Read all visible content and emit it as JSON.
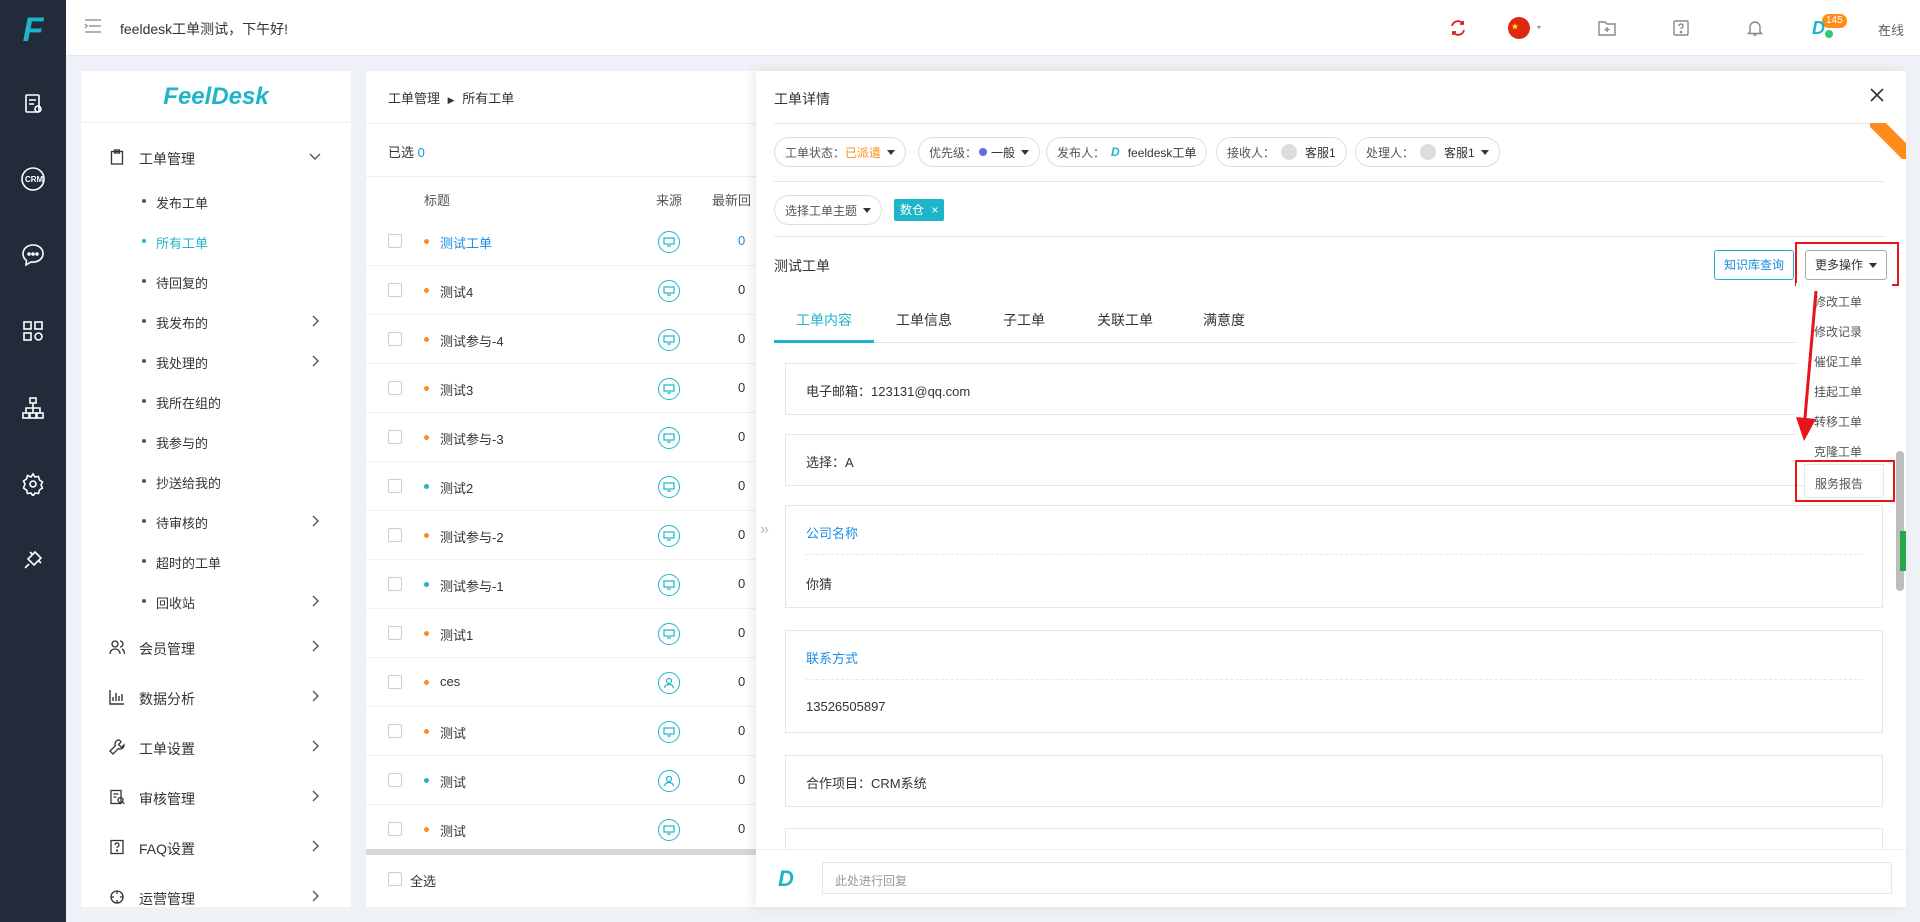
{
  "topbar": {
    "greeting": "feeldesk工单测试，下午好!",
    "notify_count": "145",
    "status": "在线"
  },
  "sidebar": {
    "brand": "FeelDesk",
    "groups": [
      {
        "label": "工单管理"
      },
      {
        "label": "会员管理"
      },
      {
        "label": "数据分析"
      },
      {
        "label": "工单设置"
      },
      {
        "label": "审核管理"
      },
      {
        "label": "FAQ设置"
      },
      {
        "label": "运营管理"
      }
    ],
    "items": [
      {
        "label": "发布工单"
      },
      {
        "label": "所有工单"
      },
      {
        "label": "待回复的"
      },
      {
        "label": "我发布的"
      },
      {
        "label": "我处理的"
      },
      {
        "label": "我所在组的"
      },
      {
        "label": "我参与的"
      },
      {
        "label": "抄送给我的"
      },
      {
        "label": "待审核的"
      },
      {
        "label": "超时的工单"
      },
      {
        "label": "回收站"
      }
    ]
  },
  "list": {
    "breadcrumb_root": "工单管理",
    "breadcrumb_current": "所有工单",
    "selected_label": "已选",
    "selected_count": "0",
    "columns": {
      "title": "标题",
      "source": "来源",
      "latest": "最新回"
    },
    "rows": [
      {
        "title": "测试工单",
        "num": "0"
      },
      {
        "title": "测试4",
        "num": "0"
      },
      {
        "title": "测试参与-4",
        "num": "0"
      },
      {
        "title": "测试3",
        "num": "0"
      },
      {
        "title": "测试参与-3",
        "num": "0"
      },
      {
        "title": "测试2",
        "num": "0"
      },
      {
        "title": "测试参与-2",
        "num": "0"
      },
      {
        "title": "测试参与-1",
        "num": "0"
      },
      {
        "title": "测试1",
        "num": "0"
      },
      {
        "title": "ces",
        "num": "0"
      },
      {
        "title": "测试",
        "num": "0"
      },
      {
        "title": "测试",
        "num": "0"
      },
      {
        "title": "测试",
        "num": "0"
      }
    ],
    "select_all": "全选"
  },
  "detail": {
    "header": "工单详情",
    "chips": {
      "status_label": "工单状态：",
      "status_value": "已派遣",
      "priority_label": "优先级：",
      "priority_value": "一般",
      "publisher_label": "发布人：",
      "publisher_value": "feeldesk工单",
      "receiver_label": "接收人：",
      "receiver_value": "客服1",
      "handler_label": "处理人：",
      "handler_value": "客服1",
      "topic_label": "选择工单主题"
    },
    "tag": "数仓",
    "ticket_title": "测试工单",
    "kb_button": "知识库查询",
    "more_button": "更多操作",
    "tabs": [
      "工单内容",
      "工单信息",
      "子工单",
      "关联工单",
      "满意度"
    ],
    "fields": {
      "email": "电子邮箱：123131@qq.com",
      "select": "选择：A",
      "company_label": "公司名称",
      "company_value": "你猜",
      "contact_label": "联系方式",
      "contact_value": "13526505897",
      "project": "合作项目：CRM系统"
    },
    "menu": [
      "修改工单",
      "修改记录",
      "催促工单",
      "挂起工单",
      "转移工单",
      "克隆工单",
      "服务报告"
    ],
    "reply_placeholder": "此处进行回复"
  },
  "colors": {
    "accent": "#1fb5c8",
    "status": "#ff8c1a",
    "highlight": "#e7141a"
  }
}
